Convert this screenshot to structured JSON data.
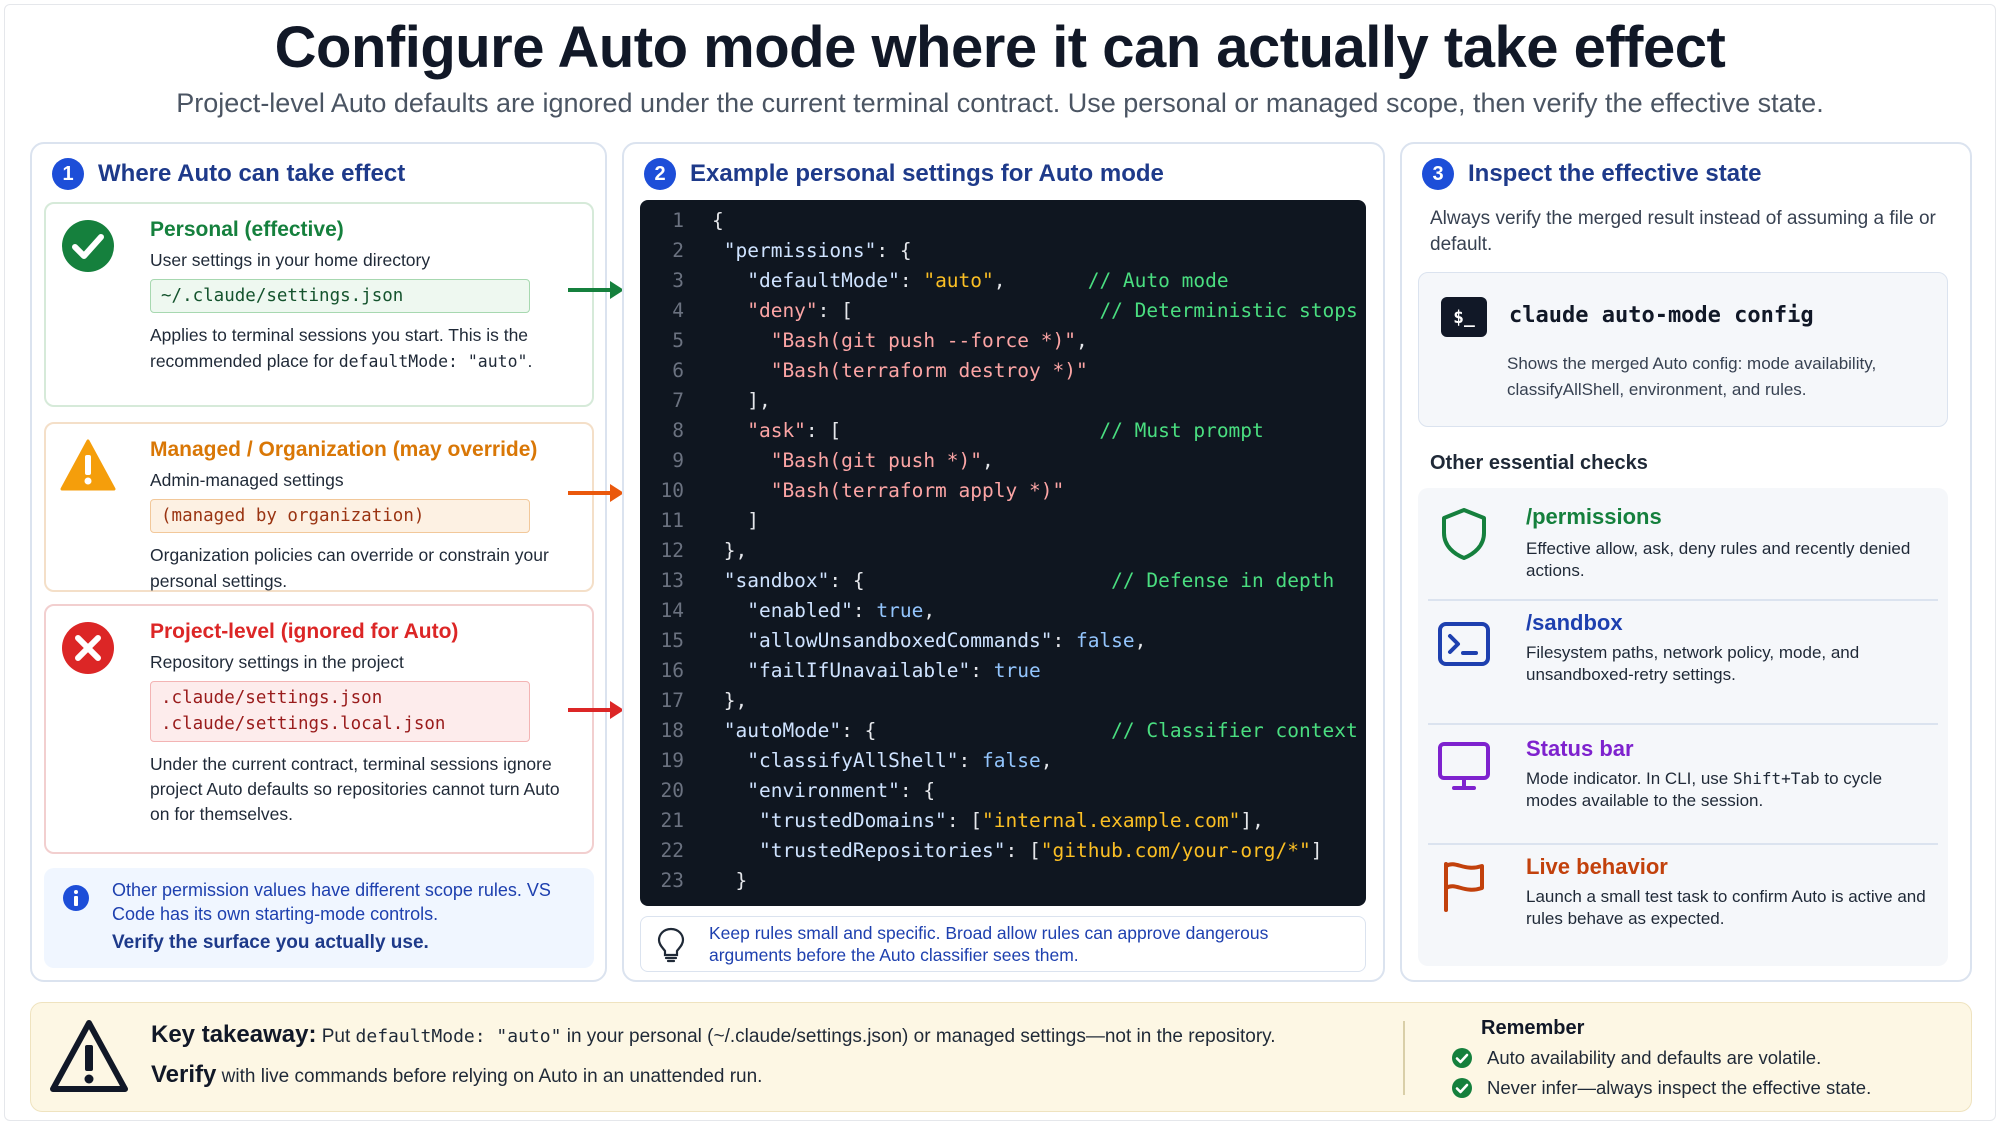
{
  "header": {
    "title": "Configure Auto mode where it can actually take effect",
    "subtitle": "Project-level Auto defaults are ignored under the current terminal contract. Use personal or managed scope, then verify the effective state."
  },
  "panel1": {
    "step": "1",
    "title": "Where Auto can take effect",
    "cards": [
      {
        "title": "Personal (effective)",
        "subtitle": "User settings in your home directory",
        "paths": [
          "~/.claude/settings.json"
        ],
        "desc": "Applies to terminal sessions you start. This is the recommended place for",
        "desc_code": "defaultMode: \"auto\"",
        "desc_end": ".",
        "color": "#15803d",
        "icon": "check-circle-icon"
      },
      {
        "title": "Managed / Organization (may override)",
        "subtitle": "Admin-managed settings",
        "paths": [
          "(managed by organization)"
        ],
        "desc": "Organization policies can override or constrain your personal settings.",
        "color": "#d97706",
        "icon": "warning-triangle-icon"
      },
      {
        "title": "Project-level (ignored for Auto)",
        "subtitle": "Repository settings in the project",
        "paths": [
          ".claude/settings.json",
          ".claude/settings.local.json"
        ],
        "desc": "Under the current contract, terminal sessions ignore project Auto defaults so repositories cannot turn Auto on for themselves.",
        "color": "#dc2626",
        "icon": "x-circle-icon"
      }
    ],
    "note": {
      "text": "Other permission values have different scope rules. VS Code has its own starting-mode controls.",
      "strong": "Verify the surface you actually use."
    }
  },
  "panel2": {
    "step": "2",
    "title": "Example personal settings for Auto mode",
    "code_lines": [
      {
        "n": "1",
        "parts": [
          {
            "t": "{",
            "c": "punc"
          }
        ]
      },
      {
        "n": "2",
        "parts": [
          {
            "t": " \"permissions\"",
            "c": "key"
          },
          {
            "t": ": {",
            "c": "punc"
          }
        ]
      },
      {
        "n": "3",
        "parts": [
          {
            "t": "   \"defaultMode\"",
            "c": "key"
          },
          {
            "t": ": ",
            "c": "punc"
          },
          {
            "t": "\"auto\"",
            "c": "val"
          },
          {
            "t": ",       ",
            "c": "punc"
          },
          {
            "t": "// Auto mode",
            "c": "cmt"
          }
        ]
      },
      {
        "n": "4",
        "parts": [
          {
            "t": "   \"deny\"",
            "c": "str"
          },
          {
            "t": ": [                     ",
            "c": "punc"
          },
          {
            "t": "// Deterministic stops",
            "c": "cmt"
          }
        ]
      },
      {
        "n": "5",
        "parts": [
          {
            "t": "     \"Bash(git push --force *)\"",
            "c": "str"
          },
          {
            "t": ",",
            "c": "punc"
          }
        ]
      },
      {
        "n": "6",
        "parts": [
          {
            "t": "     \"Bash(terraform destroy *)\"",
            "c": "str"
          }
        ]
      },
      {
        "n": "7",
        "parts": [
          {
            "t": "   ],",
            "c": "punc"
          }
        ]
      },
      {
        "n": "8",
        "parts": [
          {
            "t": "   \"ask\"",
            "c": "str"
          },
          {
            "t": ": [                      ",
            "c": "punc"
          },
          {
            "t": "// Must prompt",
            "c": "cmt"
          }
        ]
      },
      {
        "n": "9",
        "parts": [
          {
            "t": "     \"Bash(git push *)\"",
            "c": "str"
          },
          {
            "t": ",",
            "c": "punc"
          }
        ]
      },
      {
        "n": "10",
        "parts": [
          {
            "t": "     \"Bash(terraform apply *)\"",
            "c": "str"
          }
        ]
      },
      {
        "n": "11",
        "parts": [
          {
            "t": "   ]",
            "c": "punc"
          }
        ]
      },
      {
        "n": "12",
        "parts": [
          {
            "t": " },",
            "c": "punc"
          }
        ]
      },
      {
        "n": "13",
        "parts": [
          {
            "t": " \"sandbox\"",
            "c": "key"
          },
          {
            "t": ": {                     ",
            "c": "punc"
          },
          {
            "t": "// Defense in depth",
            "c": "cmt"
          }
        ]
      },
      {
        "n": "14",
        "parts": [
          {
            "t": "   \"enabled\"",
            "c": "key"
          },
          {
            "t": ": ",
            "c": "punc"
          },
          {
            "t": "true",
            "c": "bool"
          },
          {
            "t": ",",
            "c": "punc"
          }
        ]
      },
      {
        "n": "15",
        "parts": [
          {
            "t": "   \"allowUnsandboxedCommands\"",
            "c": "key"
          },
          {
            "t": ": ",
            "c": "punc"
          },
          {
            "t": "false",
            "c": "bool"
          },
          {
            "t": ",",
            "c": "punc"
          }
        ]
      },
      {
        "n": "16",
        "parts": [
          {
            "t": "   \"failIfUnavailable\"",
            "c": "key"
          },
          {
            "t": ": ",
            "c": "punc"
          },
          {
            "t": "true",
            "c": "bool"
          }
        ]
      },
      {
        "n": "17",
        "parts": [
          {
            "t": " },",
            "c": "punc"
          }
        ]
      },
      {
        "n": "18",
        "parts": [
          {
            "t": " \"autoMode\"",
            "c": "key"
          },
          {
            "t": ": {                    ",
            "c": "punc"
          },
          {
            "t": "// Classifier context",
            "c": "cmt"
          }
        ]
      },
      {
        "n": "19",
        "parts": [
          {
            "t": "   \"classifyAllShell\"",
            "c": "key"
          },
          {
            "t": ": ",
            "c": "punc"
          },
          {
            "t": "false",
            "c": "bool"
          },
          {
            "t": ",",
            "c": "punc"
          }
        ]
      },
      {
        "n": "20",
        "parts": [
          {
            "t": "   \"environment\"",
            "c": "key"
          },
          {
            "t": ": {",
            "c": "punc"
          }
        ]
      },
      {
        "n": "21",
        "parts": [
          {
            "t": "    \"trustedDomains\"",
            "c": "key"
          },
          {
            "t": ": [",
            "c": "punc"
          },
          {
            "t": "\"internal.example.com\"",
            "c": "val"
          },
          {
            "t": "],",
            "c": "punc"
          }
        ]
      },
      {
        "n": "22",
        "parts": [
          {
            "t": "    \"trustedRepositories\"",
            "c": "key"
          },
          {
            "t": ": [",
            "c": "punc"
          },
          {
            "t": "\"github.com/your-org/*\"",
            "c": "val"
          },
          {
            "t": "]",
            "c": "punc"
          }
        ]
      },
      {
        "n": "23",
        "parts": [
          {
            "t": "  }",
            "c": "punc"
          }
        ]
      }
    ],
    "tip": "Keep rules small and specific. Broad allow rules can approve dangerous arguments before the Auto classifier sees them."
  },
  "panel3": {
    "step": "3",
    "title": "Inspect the effective state",
    "intro": "Always verify the merged result instead of assuming a file or default.",
    "command": {
      "icon_label": "$_",
      "text": "claude auto-mode config",
      "desc": "Shows the merged Auto config: mode availability, classifyAllShell, environment, and rules."
    },
    "checks_title": "Other essential checks",
    "checks": [
      {
        "title": "/permissions",
        "desc": "Effective allow, ask, deny rules and recently denied actions.",
        "color": "#15803d",
        "icon": "shield-icon"
      },
      {
        "title": "/sandbox",
        "desc": "Filesystem paths, network policy, mode, and unsandboxed-retry settings.",
        "color": "#1e40af",
        "icon": "terminal-icon"
      },
      {
        "title": "Status bar",
        "desc_pre": "Mode indicator. In CLI, use",
        "desc_code": "Shift+Tab",
        "desc_post": "to cycle modes available to the session.",
        "color": "#7e22ce",
        "icon": "monitor-icon"
      },
      {
        "title": "Live behavior",
        "desc": "Launch a small test task to confirm Auto is active and rules behave as expected.",
        "color": "#c2410c",
        "icon": "flag-icon"
      }
    ]
  },
  "footer": {
    "kt_label": "Key takeaway:",
    "kt_pre": "Put",
    "kt_code": "defaultMode: \"auto\"",
    "kt_post": "in your personal (~/.claude/settings.json) or managed settings—not in the repository.",
    "verify_label": "Verify",
    "verify_text": "with live commands before relying on Auto in an unattended run.",
    "remember_title": "Remember",
    "remember_items": [
      "Auto availability and defaults are volatile.",
      "Never infer—always inspect the effective state."
    ]
  },
  "colors": {
    "accent": "#1d4ed8",
    "green": "#15803d",
    "orange": "#d97706",
    "red": "#dc2626",
    "code_bg": "#0f1620"
  }
}
